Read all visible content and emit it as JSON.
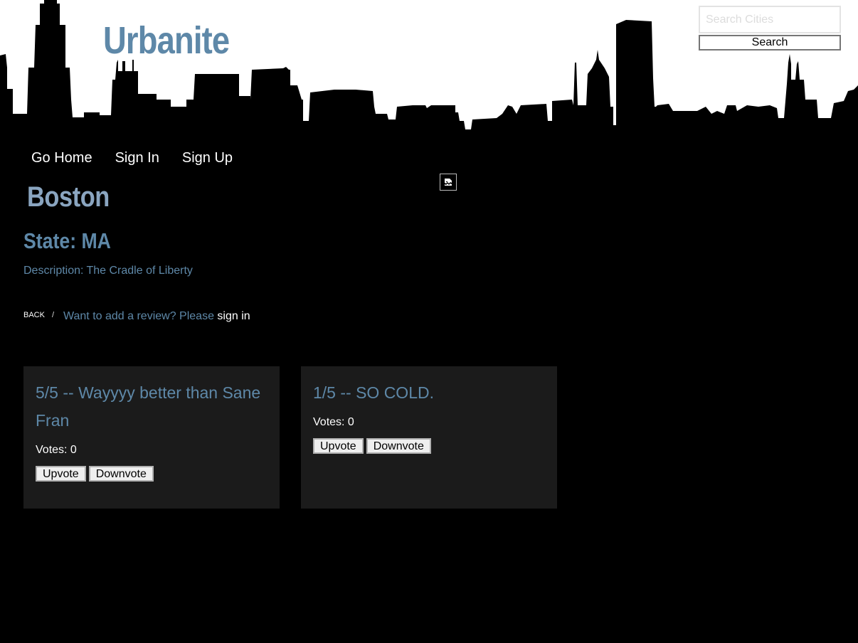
{
  "site": {
    "brand": "Urbanite"
  },
  "search": {
    "placeholder": "Search Cities",
    "value": "",
    "button_label": "Search"
  },
  "nav": {
    "items": [
      {
        "label": "Go Home"
      },
      {
        "label": "Sign In"
      },
      {
        "label": "Sign Up"
      }
    ]
  },
  "broken_image": {
    "icon": "broken-image-icon"
  },
  "city": {
    "name": "Boston",
    "state_label": "State: MA",
    "description_label": "Description:",
    "description": "The Cradle of Liberty"
  },
  "breadcrumb": {
    "back_label": "BACK",
    "separator": "/",
    "prompt": "Want to add a review? Please",
    "signin_link": "sign in"
  },
  "reviews": [
    {
      "title": "5/5 -- Wayyyy better than Sane Fran",
      "votes_text": "Votes: 0",
      "upvote_label": "Upvote",
      "downvote_label": "Downvote"
    },
    {
      "title": "1/5 -- SO COLD.",
      "votes_text": "Votes: 0",
      "upvote_label": "Upvote",
      "downvote_label": "Downvote"
    }
  ],
  "colors": {
    "background": "#000000",
    "accent": "#5e88a8",
    "city_title": "#8aa5c0",
    "card_background": "#1b1b1b"
  }
}
